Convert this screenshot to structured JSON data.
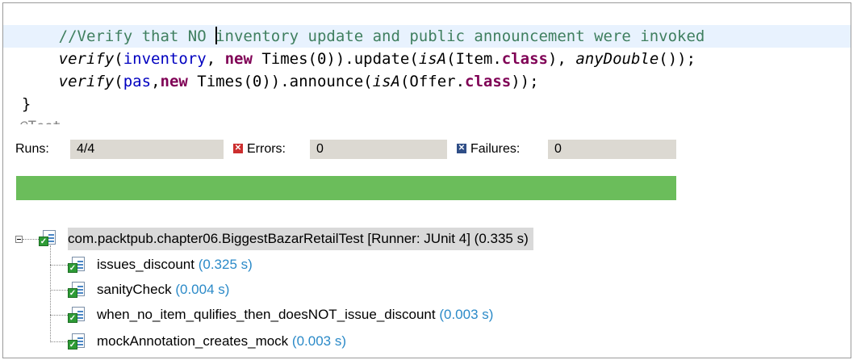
{
  "editor": {
    "line1": {
      "indent": "      ",
      "comment_before_caret": "//Verify that NO ",
      "comment_after_caret": "inventory update and public announcement were invoked"
    },
    "line2": {
      "indent": "      ",
      "verify": "verify",
      "p1": "(",
      "field": "inventory",
      "p2": ", ",
      "kw_new": "new",
      "p3": " Times(0)).update(",
      "isA": "isA",
      "p4": "(Item.",
      "kw_class": "class",
      "p5": "), ",
      "anyDouble": "anyDouble",
      "p6": "());"
    },
    "line3": {
      "indent": "      ",
      "verify": "verify",
      "p1": "(",
      "field": "pas",
      "p2": ",",
      "kw_new": "new",
      "p3": " Times(0)).announce(",
      "isA": "isA",
      "p4": "(Offer.",
      "kw_class": "class",
      "p5": "));"
    },
    "line4": "  }",
    "line5": "  @Test"
  },
  "counters": {
    "runs_label": "Runs:",
    "runs_value": "4/4",
    "errors_label": "Errors:",
    "errors_value": "0",
    "failures_label": "Failures:",
    "failures_value": "0"
  },
  "colors": {
    "progress": "#6bbd5b",
    "time": "#2b8ac8",
    "keyword": "#7f0055",
    "comment": "#3f7f5f"
  },
  "tree": {
    "root": {
      "label": "com.packtpub.chapter06.BiggestBazarRetailTest [Runner: JUnit 4]",
      "time": "(0.335 s)"
    },
    "tests": [
      {
        "label": "issues_discount",
        "time": "(0.325 s)"
      },
      {
        "label": "sanityCheck",
        "time": "(0.004 s)"
      },
      {
        "label": "when_no_item_qulifies_then_doesNOT_issue_discount",
        "time": "(0.003 s)"
      },
      {
        "label": "mockAnnotation_creates_mock",
        "time": "(0.003 s)"
      }
    ]
  }
}
